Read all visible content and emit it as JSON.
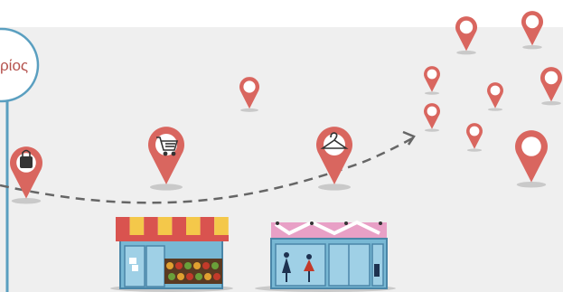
{
  "scene": {
    "circle_label": "ρίος",
    "colors": {
      "background_top": "#ffffff",
      "background_main": "#efefef",
      "pin": "#d9665f",
      "pin_hole": "#ffffff",
      "circle_border": "#5a9fc0",
      "label": "#b5534e",
      "path_dash": "#666666",
      "awning_red": "#d9534f",
      "awning_yellow": "#f4c84a",
      "store_blue": "#78b8d4",
      "store_frame": "#4a86a8",
      "store_pink": "#e8a0c6",
      "shadow": "#c9c9c9"
    },
    "pins": [
      {
        "name": "bag-pin",
        "icon": "shopping-bag-icon"
      },
      {
        "name": "cart-pin",
        "icon": "shopping-cart-icon"
      },
      {
        "name": "hanger-pin",
        "icon": "clothes-hanger-icon"
      },
      {
        "name": "plain-pin",
        "icon": "none"
      }
    ],
    "storefronts": [
      {
        "name": "grocery-storefront",
        "icon": "produce-stand-icon"
      },
      {
        "name": "clothing-storefront",
        "icon": "boutique-icon"
      }
    ]
  }
}
